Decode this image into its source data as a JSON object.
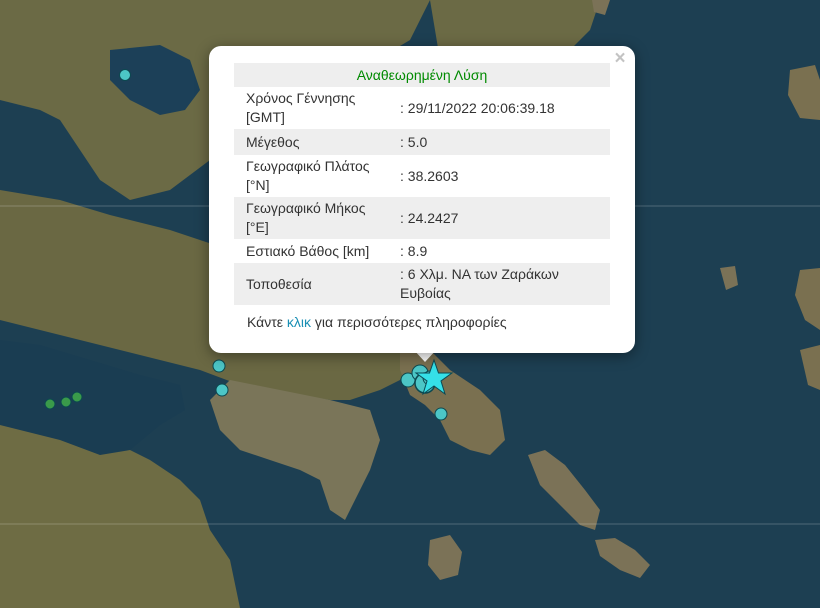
{
  "map": {
    "colors": {
      "sea": "#1d3f52",
      "land": "#6b6a45",
      "marker_fill": "#4cc6c6",
      "marker_stroke": "#0c4850",
      "old_marker_fill": "#3a9a4a",
      "star": "#35e0e8"
    },
    "markers_icon": "circle-marker-icon",
    "epicenter_icon": "star-icon"
  },
  "popup": {
    "title": "Αναθεωρημένη Λύση",
    "rows": [
      {
        "label": "Χρόνος Γέννησης [GMT]",
        "value": ": 29/11/2022 20:06:39.18"
      },
      {
        "label": "Μέγεθος",
        "value": ": 5.0"
      },
      {
        "label": "Γεωγραφικό Πλάτος [°N]",
        "value": ": 38.2603"
      },
      {
        "label": "Γεωγραφικό Μήκος [°E]",
        "value": ": 24.2427"
      },
      {
        "label": "Εστιακό Βάθος [km]",
        "value": ": 8.9"
      },
      {
        "label": "Τοποθεσία",
        "value": ": 6 Χλμ. ΝΑ των Ζαράκων Ευβοίας"
      }
    ],
    "more_prefix": "Κάντε ",
    "more_link": "κλικ",
    "more_suffix": " για περισσότερες πληροφορίες",
    "close_glyph": "×"
  }
}
